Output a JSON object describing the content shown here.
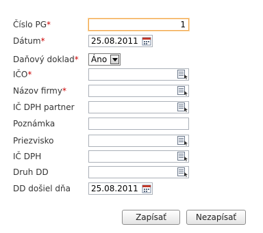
{
  "form": {
    "fields": [
      {
        "label": "Číslo PG",
        "required": true,
        "value": "1",
        "type": "text"
      },
      {
        "label": "Dátum",
        "required": true,
        "value": "25.08.2011",
        "type": "date"
      },
      {
        "label": "Daňový doklad",
        "required": true,
        "value": "Áno",
        "type": "select"
      },
      {
        "label": "IČO",
        "required": true,
        "value": "",
        "type": "lookup"
      },
      {
        "label": "Názov firmy",
        "required": true,
        "value": "",
        "type": "lookup"
      },
      {
        "label": "IČ DPH partner",
        "required": false,
        "value": "",
        "type": "lookup"
      },
      {
        "label": "Poznámka",
        "required": false,
        "value": "",
        "type": "text"
      },
      {
        "label": "Priezvisko",
        "required": false,
        "value": "",
        "type": "lookup"
      },
      {
        "label": "IČ DPH",
        "required": false,
        "value": "",
        "type": "lookup"
      },
      {
        "label": "Druh DD",
        "required": false,
        "value": "",
        "type": "lookup"
      },
      {
        "label": "DD došiel dňa",
        "required": false,
        "value": "25.08.2011",
        "type": "date"
      }
    ],
    "required_marker": "*"
  },
  "buttons": {
    "save_label": "Zapísať",
    "cancel_label": "Nezapísať"
  },
  "icons": {
    "lookup": "list-lookup-icon",
    "calendar": "calendar-icon",
    "dropdown": "chevron-down-icon"
  },
  "colors": {
    "required": "#cc0000",
    "focus_border": "#f2a64a",
    "input_border": "#aab0b8"
  }
}
